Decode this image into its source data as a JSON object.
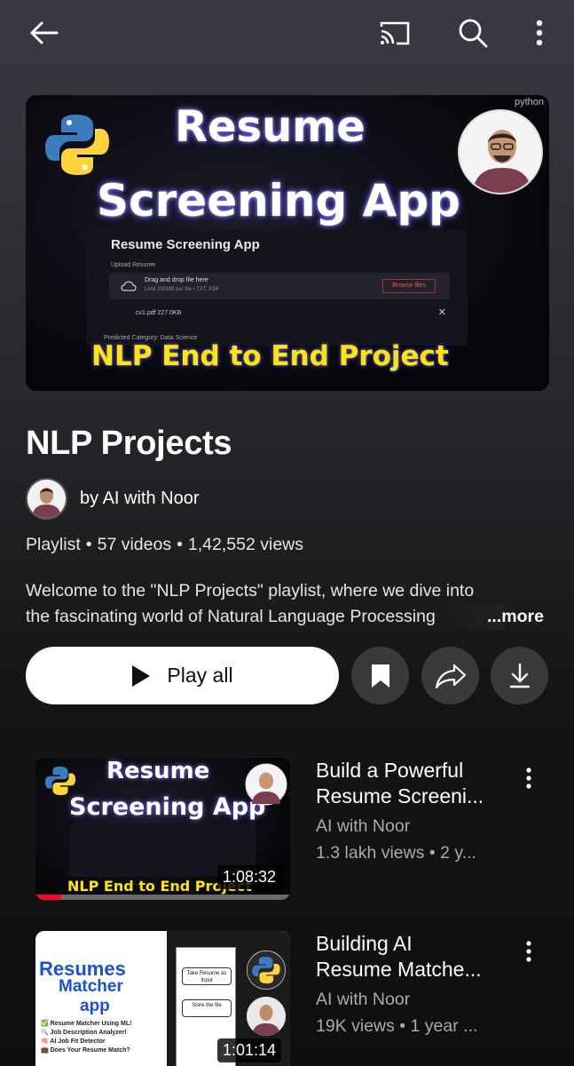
{
  "icons": {
    "back": "arrow-left-icon",
    "cast": "cast-icon",
    "search": "search-icon",
    "more": "more-vertical-icon"
  },
  "hero": {
    "title_line1": "Resume",
    "title_line2": "Screening App",
    "badge": "python",
    "app_title": "Resume Screening App",
    "app_upload_label": "Upload Resume",
    "app_drop_text": "Drag and drop file here",
    "app_drop_limit": "Limit 200MB per file • TXT, PDF",
    "app_browse": "Browse files",
    "app_file": "cv1.pdf  227.0KB",
    "app_category": "Predicted Category: Data Science",
    "banner": "NLP End to End Project"
  },
  "playlist": {
    "title": "NLP Projects",
    "owner": "by AI with Noor",
    "type": "Playlist",
    "video_count": "57 videos",
    "views": "1,42,552 views",
    "description_line1": "Welcome to the \"NLP Projects\" playlist, where we dive into",
    "description_line2": "the fascinating world of Natural Language Processing",
    "more_label": "...more"
  },
  "actions": {
    "play_all": "Play all"
  },
  "videos": [
    {
      "title_line1": "Build a Powerful",
      "title_line2": "Resume Screeni...",
      "channel": "AI with Noor",
      "stats": "1.3 lakh views • 2 y...",
      "duration": "1:08:32",
      "watched_fraction": 0.1,
      "thumb_title1": "Resume",
      "thumb_title2": "Screening App",
      "thumb_banner": "NLP End to End Project"
    },
    {
      "title_line1": "Building AI",
      "title_line2": "Resume Matche...",
      "channel": "AI with Noor",
      "stats": "19K views • 1 year ...",
      "duration": "1:01:14",
      "thumb_line1": "Resumes",
      "thumb_line2": "Matcher",
      "thumb_line3": "app",
      "thumb_bullets": [
        "✅ Resume Matcher Using ML!",
        "🔍 Job Description Analyzer!",
        "🧠 AI Job Fit Detector",
        "💼 Does Your Resume Match?"
      ],
      "flow_box1": "Take Resume as Input",
      "flow_box2": "Store the file"
    }
  ],
  "colors": {
    "accent_red": "#ff0033",
    "banner_yellow": "#ffe600",
    "secondary_text": "#aaaaaa"
  }
}
